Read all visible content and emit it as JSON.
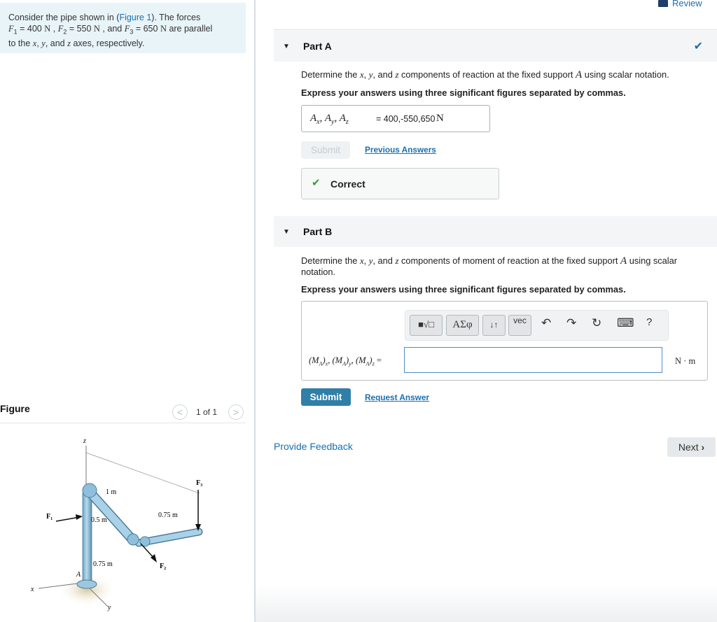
{
  "problem": {
    "text_1": "Consider the pipe shown in (",
    "figure_link": "Figure 1",
    "text_2": "). The forces",
    "f1_sym": "F",
    "f1_sub": "1",
    "f1_val": " = 400 ",
    "f2_sym": "F",
    "f2_sub": "2",
    "f2_val": " = 550 ",
    "f3_sym": "F",
    "f3_sub": "3",
    "f3_val": " = 650 ",
    "unit": "N",
    "sep1": " , ",
    "sep2": " , and ",
    "text_3": " are parallel",
    "text_4": "to the ",
    "x": "x",
    "y": "y",
    "z": "z",
    "text_5": ", ",
    "text_6": ", and ",
    "text_7": " axes, respectively."
  },
  "header": {
    "review_label": "Review"
  },
  "figure": {
    "label": "Figure",
    "prev_icon": "<",
    "next_icon": ">",
    "count": "1 of 1",
    "labels": {
      "z": "z",
      "x": "x",
      "y": "y",
      "F1": "F",
      "F1_sub": "1",
      "F2": "F",
      "F2_sub": "2",
      "F3": "F",
      "F3_sub": "3",
      "A": "A",
      "d1": "1 m",
      "d2": "0.5 m",
      "d3": "0.75 m",
      "d4": "0.75 m"
    }
  },
  "partA": {
    "triangle": "▼",
    "title": "Part A",
    "question_1": "Determine the ",
    "question_x": "x",
    "question_2": ", ",
    "question_y": "y",
    "question_3": ", and ",
    "question_z": "z",
    "question_4": " components of reaction at the fixed support ",
    "question_A": "A",
    "question_5": " using scalar notation.",
    "instruction": "Express your answers using three significant figures separated by commas.",
    "answer_label": "A",
    "answer_sub_x": "x",
    "answer_sub_y": "y",
    "answer_sub_z": "z",
    "answer_value": "400,-550,650",
    "answer_unit": "N",
    "submit_label": "Submit",
    "previous_answers_label": "Previous Answers",
    "correct_icon": "✔",
    "correct_label": "Correct",
    "status_icon": "✔"
  },
  "partB": {
    "triangle": "▼",
    "title": "Part B",
    "question_1": "Determine the ",
    "question_x": "x",
    "question_2": ", ",
    "question_y": "y",
    "question_3": ", and ",
    "question_z": "z",
    "question_4": " components of moment of reaction at the fixed support ",
    "question_A": "A",
    "question_5": " using scalar notation.",
    "instruction": "Express your answers using three significant figures separated by commas.",
    "toolbar": {
      "templates_label": "■√□",
      "greek_label": "ΑΣφ",
      "arrows_label": "↓↑",
      "vec_label": "vec",
      "undo_icon": "↶",
      "redo_icon": "↷",
      "reset_icon": "↻",
      "keyboard_icon": "⌨",
      "help_label": "?"
    },
    "input_label": "(M_A)x, (M_A)y, (M_A)z =",
    "input_value": "",
    "unit": "N · m",
    "submit_label": "Submit",
    "request_answer_label": "Request Answer"
  },
  "footer": {
    "feedback_label": "Provide Feedback",
    "next_label": "Next",
    "next_icon": "›"
  }
}
